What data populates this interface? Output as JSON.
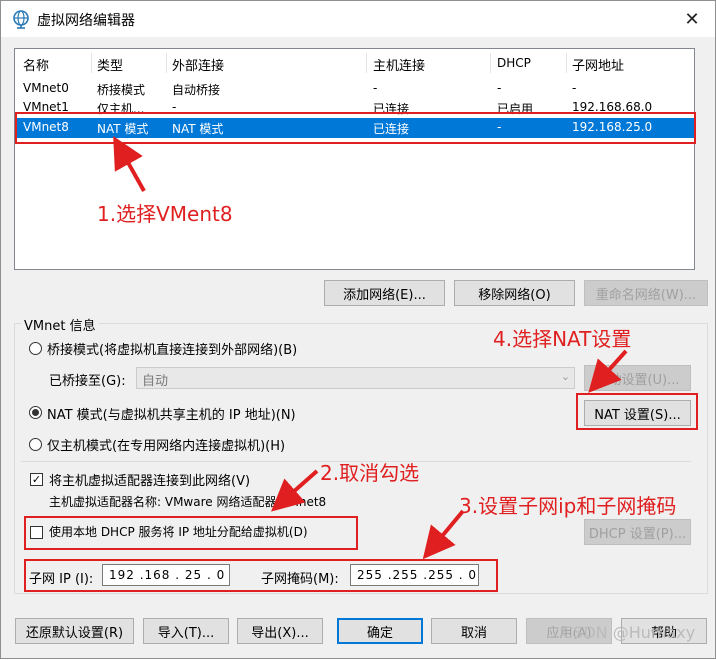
{
  "window": {
    "title": "虚拟网络编辑器",
    "close_glyph": "✕"
  },
  "table": {
    "headers": [
      "名称",
      "类型",
      "外部连接",
      "主机连接",
      "DHCP",
      "子网地址"
    ],
    "rows": [
      [
        "VMnet0",
        "桥接模式",
        "自动桥接",
        "-",
        "-",
        "-"
      ],
      [
        "VMnet1",
        "仅主机...",
        "-",
        "已连接",
        "已启用",
        "192.168.68.0"
      ],
      [
        "VMnet8",
        "NAT 模式",
        "NAT 模式",
        "已连接",
        "-",
        "192.168.25.0"
      ]
    ],
    "selected_index": 2
  },
  "list_buttons": {
    "add": "添加网络(E)...",
    "remove": "移除网络(O)",
    "rename": "重命名网络(W)..."
  },
  "vmnet_info": {
    "group_label": "VMnet 信息",
    "bridge_radio": "桥接模式(将虚拟机直接连接到外部网络)(B)",
    "bridged_to_label": "已桥接至(G):",
    "bridged_to_value": "自动",
    "auto_settings_button": "自动设置(U)...",
    "nat_radio": "NAT 模式(与虚拟机共享主机的 IP 地址)(N)",
    "nat_settings_button": "NAT 设置(S)...",
    "hostonly_radio": "仅主机模式(在专用网络内连接虚拟机)(H)",
    "selected_mode": "nat",
    "connect_adapter_check": "将主机虚拟适配器连接到此网络(V)",
    "connect_adapter_checked": true,
    "adapter_name_label": "主机虚拟适配器名称: VMware 网络适配器 VMnet8",
    "dhcp_check": "使用本地 DHCP 服务将 IP 地址分配给虚拟机(D)",
    "dhcp_checked": false,
    "dhcp_settings_button": "DHCP 设置(P)...",
    "subnet_ip_label": "子网 IP (I):",
    "subnet_ip_value": "192 .168 . 25  .  0",
    "subnet_mask_label": "子网掩码(M):",
    "subnet_mask_value": "255 .255 .255 .  0"
  },
  "bottom_buttons": {
    "restore": "还原默认设置(R)",
    "import": "导入(T)...",
    "export": "导出(X)...",
    "ok": "确定",
    "cancel": "取消",
    "apply": "应用(A)",
    "help": "帮助"
  },
  "annotations": {
    "step1": "1.选择VMent8",
    "step2": "2.取消勾选",
    "step3": "3.设置子网ip和子网掩码",
    "step4": "4.选择NAT设置",
    "color": "#e02020"
  },
  "watermark": "CSDN @Humaxy",
  "colors": {
    "selection": "#0078d7",
    "dialog_bg": "#f0f0f0"
  }
}
